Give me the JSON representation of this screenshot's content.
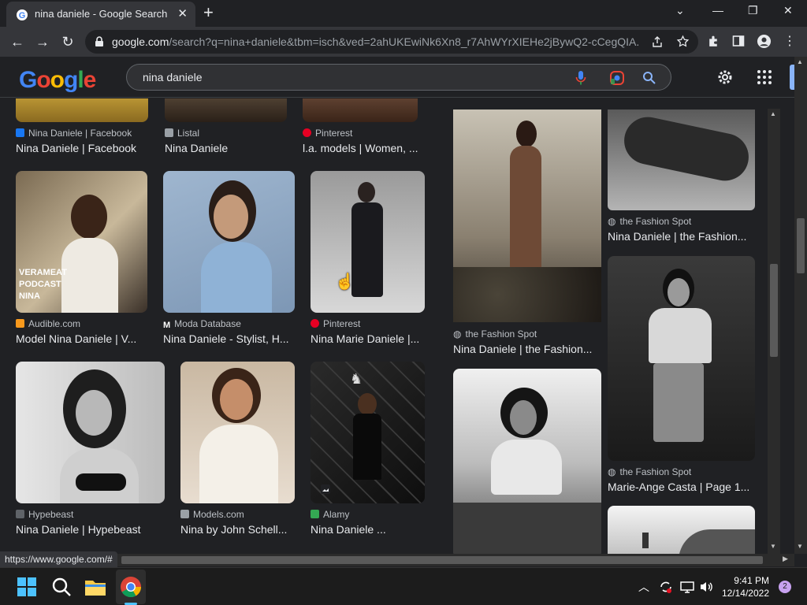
{
  "browser": {
    "tab_title": "nina daniele - Google Search",
    "tab_close": "✕",
    "new_tab": "+",
    "url_domain": "google.com",
    "url_rest": "/search?q=nina+daniele&tbm=isch&ved=2ahUKEwiNk6Xn8_r7AhWYrXIEHe2jBywQ2-cCegQIA...",
    "status_url": "https://www.google.com/#"
  },
  "google": {
    "logo_letters": [
      "G",
      "o",
      "o",
      "g",
      "l",
      "e"
    ],
    "query": "nina daniele"
  },
  "colors": {
    "logo": [
      "#4285f4",
      "#ea4335",
      "#fbbc05",
      "#4285f4",
      "#34a853",
      "#ea4335"
    ]
  },
  "left_results": [
    {
      "source": "Nina Daniele | Facebook",
      "caption": "Nina Daniele | Facebook",
      "icon_color": "#1877f2"
    },
    {
      "source": "Listal",
      "caption": "Nina Daniele",
      "icon_color": "#9aa0a6"
    },
    {
      "source": "Pinterest",
      "caption": "l.a. models | Women, ...",
      "icon_color": "#e60023"
    },
    {
      "source": "Audible.com",
      "caption": "Model Nina Daniele | V...",
      "icon_color": "#f7991c"
    },
    {
      "source": "Moda Database",
      "caption": "Nina Daniele - Stylist, H...",
      "icon_color": "#ffffff"
    },
    {
      "source": "Pinterest",
      "caption": "Nina Marie Daniele |...",
      "icon_color": "#e60023"
    },
    {
      "source": "Hypebeast",
      "caption": "Nina Daniele | Hypebeast",
      "icon_color": "#5f6368"
    },
    {
      "source": "Models.com",
      "caption": "Nina by John Schell...",
      "icon_color": "#9aa0a6"
    },
    {
      "source": "Alamy",
      "caption": "Nina Daniele ...",
      "icon_color": "#34a853"
    }
  ],
  "podcast_overlay": [
    "VERAMEAT",
    "PODCAST",
    "NINA"
  ],
  "right_results": [
    {
      "source": "the Fashion Spot",
      "caption": "Nina Daniele | the Fashion..."
    },
    {
      "source": "the Fashion Spot",
      "caption": "Nina Daniele | the Fashion..."
    },
    {
      "source": "the Fashion Spot",
      "caption": "Marie-Ange Casta | Page 1..."
    }
  ],
  "taskbar": {
    "time": "9:41 PM",
    "date": "12/14/2022",
    "notif_count": "2"
  }
}
